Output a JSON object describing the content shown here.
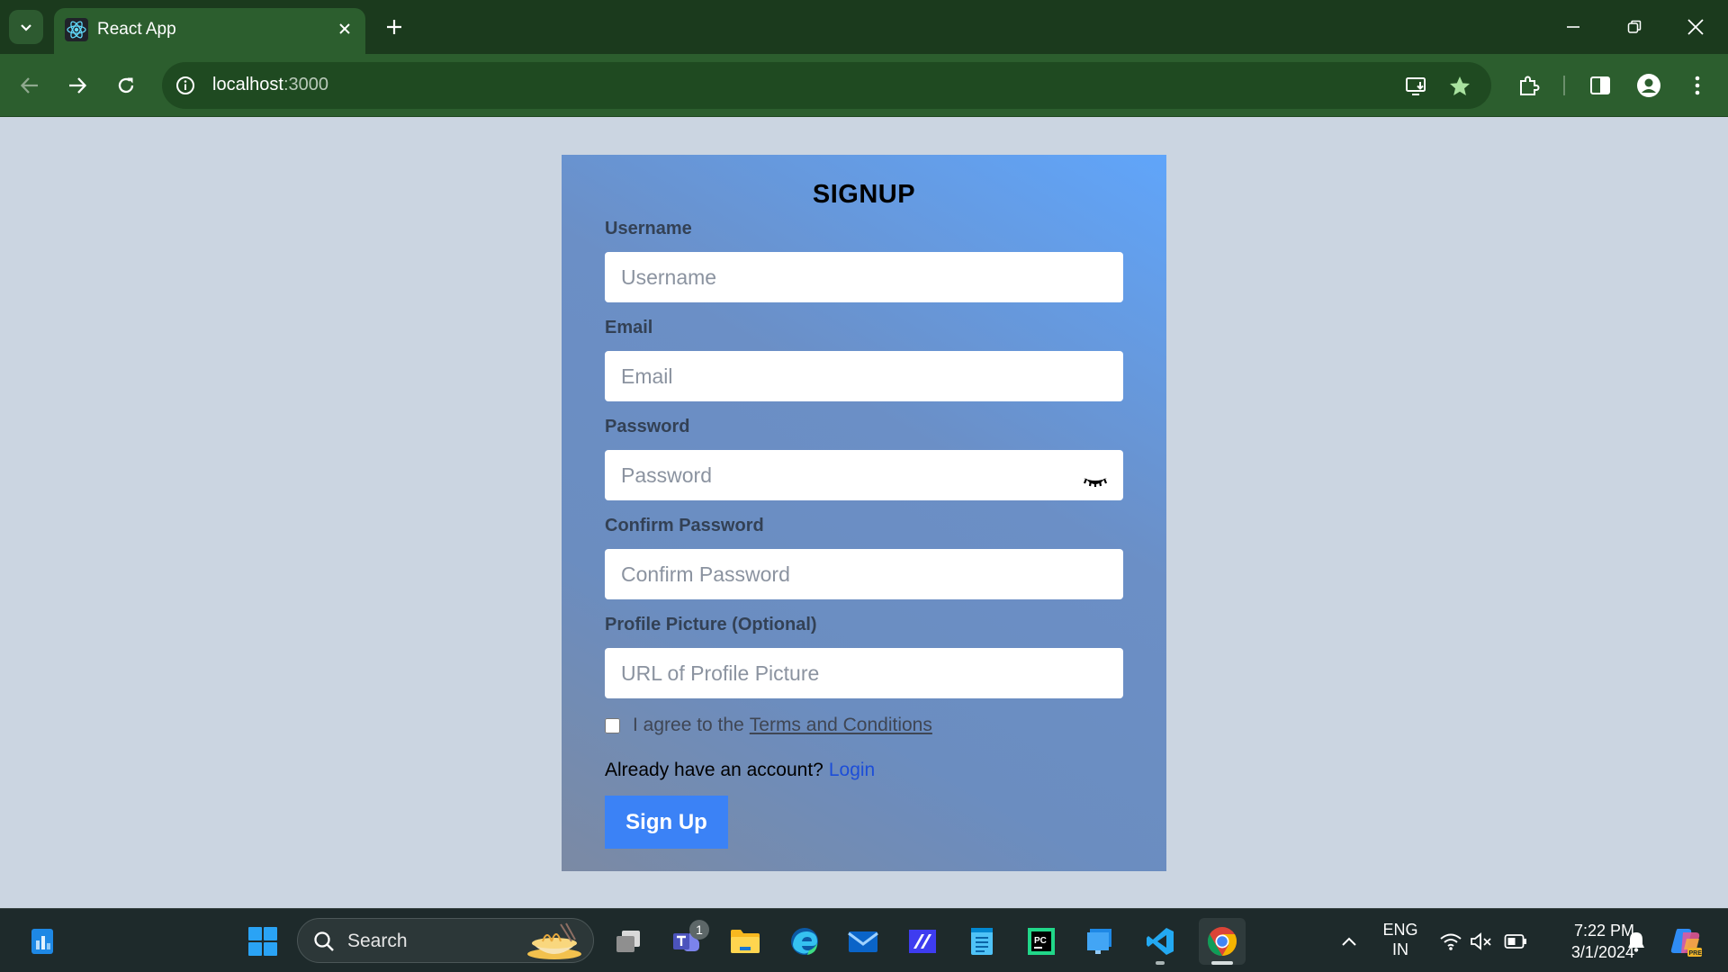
{
  "browser": {
    "tab_title": "React App",
    "url_host": "localhost",
    "url_port": ":3000"
  },
  "form": {
    "title": "SIGNUP",
    "username_label": "Username",
    "username_placeholder": "Username",
    "email_label": "Email",
    "email_placeholder": "Email",
    "password_label": "Password",
    "password_placeholder": "Password",
    "confirm_label": "Confirm Password",
    "confirm_placeholder": "Confirm Password",
    "picture_label": "Profile Picture (Optional)",
    "picture_placeholder": "URL of Profile Picture",
    "terms_prefix": "I agree to the",
    "terms_link": "Terms and Conditions",
    "terms_checked": false,
    "account_prompt": "Already have an account?",
    "login_link": "Login",
    "submit_label": "Sign Up"
  },
  "taskbar": {
    "search_label": "Search",
    "teams_badge": "1",
    "language_line1": "ENG",
    "language_line2": "IN",
    "time": "7:22 PM",
    "date": "3/1/2024",
    "apps": [
      "file-explorer-widget",
      "start",
      "search",
      "task-view",
      "teams",
      "file-explorer",
      "edge",
      "mail",
      "visual-studio",
      "notepad",
      "pycharm",
      "remote-desktop",
      "vscode",
      "chrome"
    ]
  },
  "colors": {
    "page_bg": "#cbd5e1",
    "card_gradient_start": "#60a5fa",
    "card_gradient_end": "#7b8aa4",
    "button_bg": "#3b82f6",
    "login_link": "#1d4ed8",
    "browser_frame": "#2c5e2e"
  }
}
